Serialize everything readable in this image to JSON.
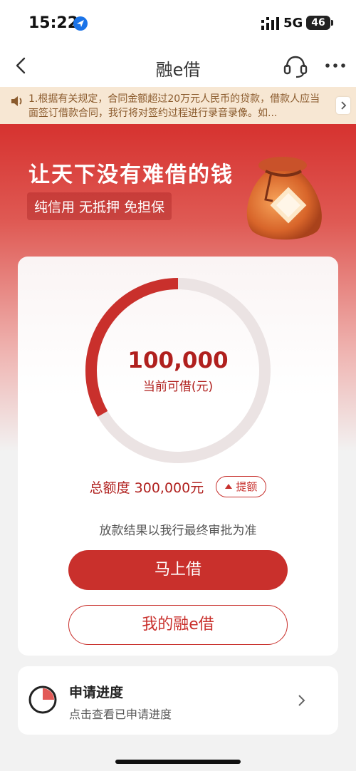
{
  "status_bar": {
    "time": "15:22",
    "network": "5G",
    "battery": "46"
  },
  "nav": {
    "title": "融e借"
  },
  "notice": {
    "text": "1.根据有关规定，合同金额超过20万元人民币的贷款，借款人应当面签订借款合同，我行将对签约过程进行录音录像。如..."
  },
  "hero": {
    "slogan": "让天下没有难借的钱",
    "tagline": "纯信用 无抵押 免担保"
  },
  "loan": {
    "available_amount": "100,000",
    "available_label": "当前可借(元)",
    "total_text": "总额度 300,000元",
    "raise_label": "提额",
    "available_fraction": 0.333,
    "note": "放款结果以我行最终审批为准",
    "borrow_button": "马上借",
    "my_loan_button": "我的融e借"
  },
  "progress": {
    "title": "申请进度",
    "subtitle": "点击查看已申请进度"
  },
  "colors": {
    "brand_red": "#c9302c",
    "ring_track": "#ebe3e3",
    "notice_bg": "#f7e7d3"
  }
}
